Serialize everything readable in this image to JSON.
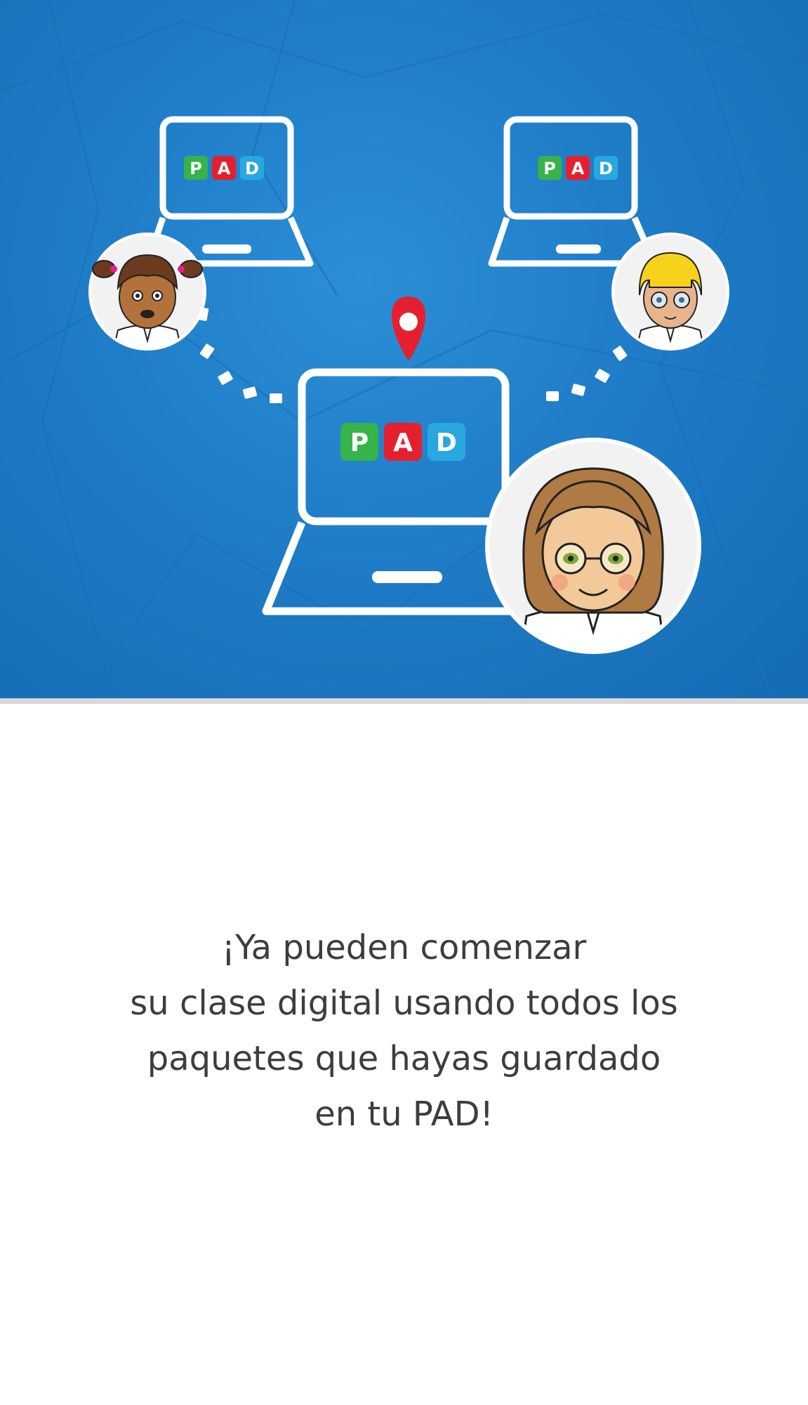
{
  "hero": {
    "device_logo_letters": [
      "P",
      "A",
      "D"
    ],
    "logo_colors": {
      "p_tile": "#36b34a",
      "a_tile": "#e5202e",
      "d_tile": "#29a8e0"
    },
    "background_color": "#1f7cc7",
    "pin_color": "#e5202e",
    "icons": [
      "laptop-icon",
      "location-pin-icon",
      "student-girl-avatar",
      "student-boy-avatar",
      "teacher-avatar"
    ]
  },
  "message": {
    "line1": "¡Ya pueden comenzar",
    "line2": "su clase digital usando todos los",
    "line3": "paquetes que hayas guardado",
    "line4": "en tu PAD!"
  }
}
